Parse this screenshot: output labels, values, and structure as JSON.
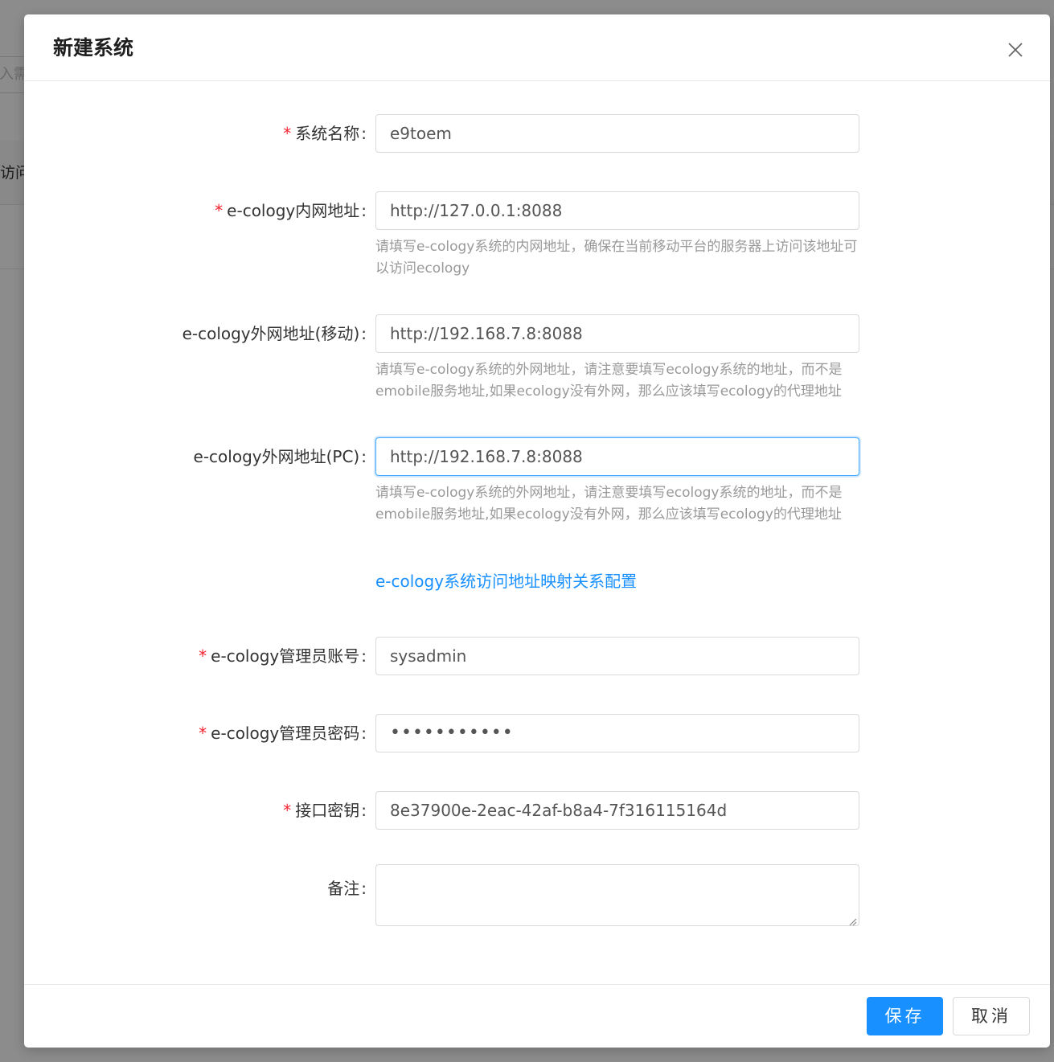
{
  "background": {
    "search_placeholder": "入需",
    "table_header_text": "访问"
  },
  "modal": {
    "title": "新建系统",
    "fields": {
      "system_name": {
        "label": "系统名称",
        "required": true,
        "value": "e9toem"
      },
      "intranet": {
        "label": "e-cology内网地址",
        "required": true,
        "value": "http://127.0.0.1:8088",
        "hint": "请填写e-cology系统的内网地址，确保在当前移动平台的服务器上访问该地址可以访问ecology"
      },
      "extranet_mobile": {
        "label": "e-cology外网地址(移动)",
        "required": false,
        "value": "http://192.168.7.8:8088",
        "hint": "请填写e-cology系统的外网地址，请注意要填写ecology系统的地址，而不是emobile服务地址,如果ecology没有外网，那么应该填写ecology的代理地址"
      },
      "extranet_pc": {
        "label": "e-cology外网地址(PC)",
        "required": false,
        "value": "http://192.168.7.8:8088",
        "hint": "请填写e-cology系统的外网地址，请注意要填写ecology系统的地址，而不是emobile服务地址,如果ecology没有外网，那么应该填写ecology的代理地址"
      },
      "admin_account": {
        "label": "e-cology管理员账号",
        "required": true,
        "value": "sysadmin"
      },
      "admin_password": {
        "label": "e-cology管理员密码",
        "required": true,
        "value": "•••••••••••"
      },
      "api_key": {
        "label": "接口密钥",
        "required": true,
        "value": "8e37900e-2eac-42af-b8a4-7f316115164d"
      },
      "remark": {
        "label": "备注",
        "required": false,
        "value": ""
      }
    },
    "mapping_link": "e-cology系统访问地址映射关系配置",
    "colon": ":",
    "required_mark": "*",
    "footer": {
      "save_label": "保存",
      "cancel_label": "取消"
    }
  },
  "icons": {
    "close": "close-icon",
    "resize": "resize-grip-icon"
  },
  "colors": {
    "primary": "#1890ff",
    "required": "#f5222d",
    "hint": "#999999",
    "focus_border": "#40a9ff"
  }
}
